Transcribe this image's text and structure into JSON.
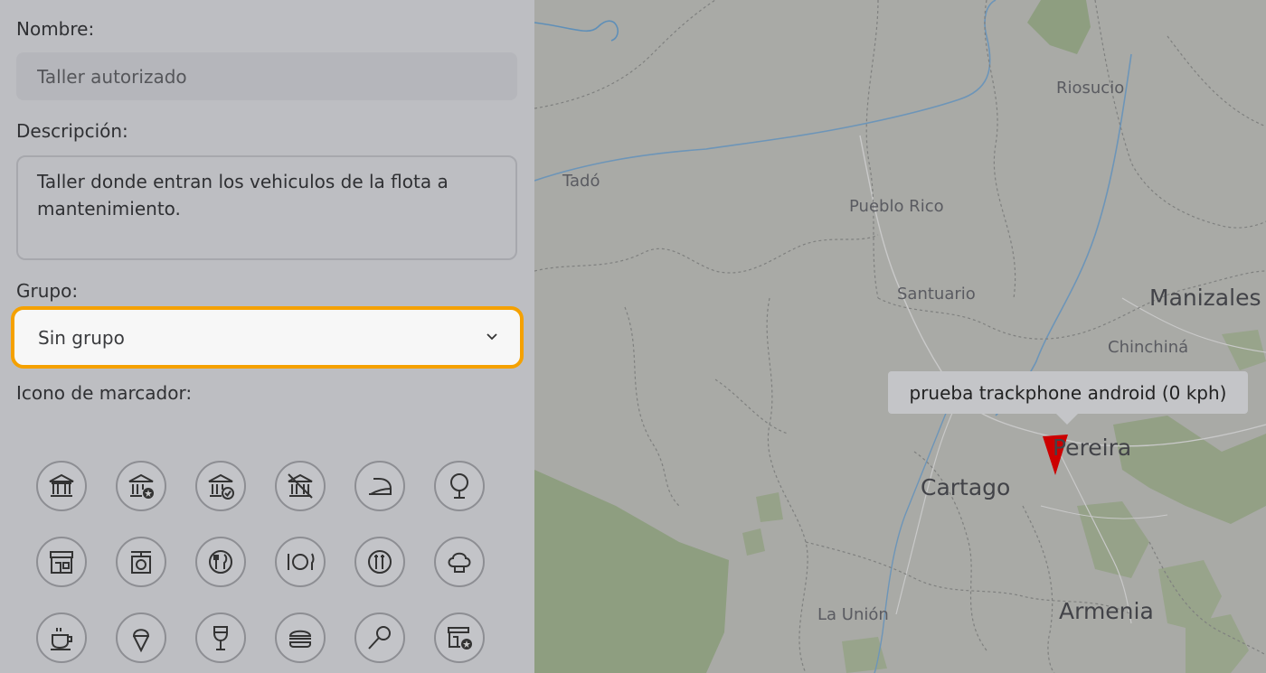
{
  "form": {
    "name_label": "Nombre:",
    "name_value": "Taller autorizado",
    "description_label": "Descripción:",
    "description_value": "Taller donde entran los vehiculos de la flota a mantenimiento.",
    "group_label": "Grupo:",
    "group_selected": "Sin grupo",
    "marker_icon_label": "Icono de marcador:"
  },
  "marker_icons": [
    "bank-icon",
    "bank-star-icon",
    "bank-check-icon",
    "bank-crossed-icon",
    "iron-icon",
    "mirror-icon",
    "store-icon",
    "scale-icon",
    "restaurant-icon",
    "plate-cutlery-icon",
    "fast-food-icon",
    "chef-hat-icon",
    "coffee-cup-icon",
    "ice-cream-icon",
    "wine-glass-icon",
    "burger-icon",
    "lollipop-icon",
    "shop-star-icon"
  ],
  "map": {
    "places": [
      {
        "name": "Riosucio",
        "size": "small"
      },
      {
        "name": "Tadó",
        "size": "small"
      },
      {
        "name": "Pueblo Rico",
        "size": "small"
      },
      {
        "name": "Santuario",
        "size": "small"
      },
      {
        "name": "Manizales",
        "size": "big"
      },
      {
        "name": "Chinchiná",
        "size": "small"
      },
      {
        "name": "Pereira",
        "size": "big"
      },
      {
        "name": "Cartago",
        "size": "big"
      },
      {
        "name": "La Unión",
        "size": "small"
      },
      {
        "name": "Armenia",
        "size": "big"
      }
    ],
    "tooltip": "prueba trackphone android (0 kph)",
    "marker_color": "#cc0000"
  },
  "colors": {
    "accent": "#f5a100"
  }
}
